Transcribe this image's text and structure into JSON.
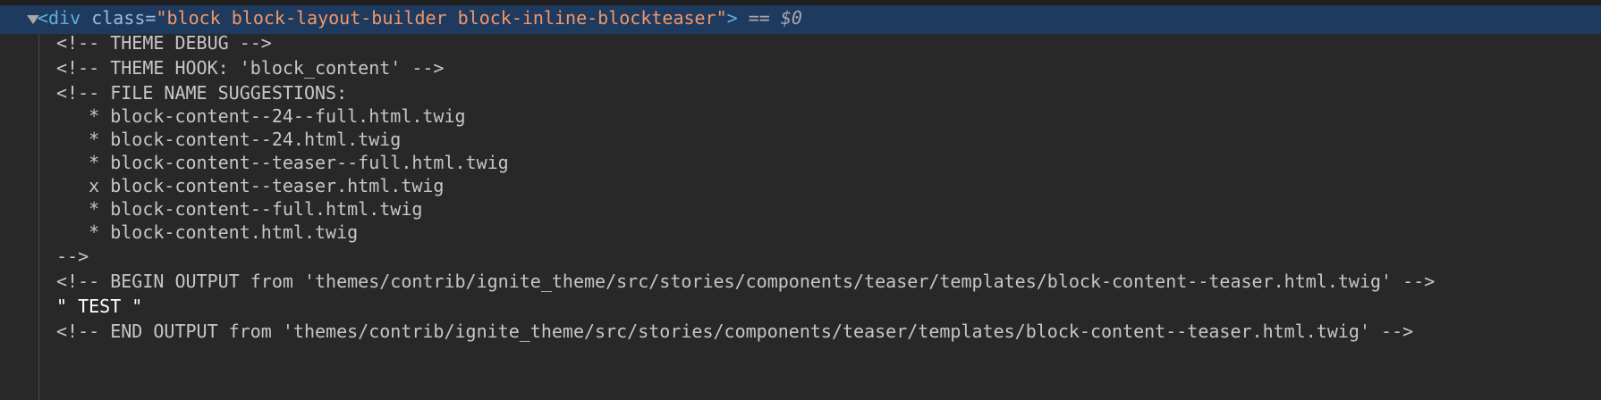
{
  "selected_element": {
    "open_bracket": "<",
    "tag": "div",
    "attr_name": " class",
    "attr_eq": "=",
    "attr_value": "\"block block-layout-builder block-inline-blockteaser\"",
    "close_bracket": ">",
    "eq_marker": " == ",
    "dollar_ref": "$0"
  },
  "comment_lines": [
    "<!-- THEME DEBUG -->",
    "<!-- THEME HOOK: 'block_content' -->",
    "<!-- FILE NAME SUGGESTIONS:",
    "   * block-content--24--full.html.twig",
    "   * block-content--24.html.twig",
    "   * block-content--teaser--full.html.twig",
    "   x block-content--teaser.html.twig",
    "   * block-content--full.html.twig",
    "   * block-content.html.twig",
    "-->",
    "<!-- BEGIN OUTPUT from 'themes/contrib/ignite_theme/src/stories/components/teaser/templates/block-content--teaser.html.twig' -->"
  ],
  "text_node": "\" TEST \"",
  "end_comment": "<!-- END OUTPUT from 'themes/contrib/ignite_theme/src/stories/components/teaser/templates/block-content--teaser.html.twig' -->",
  "colors": {
    "background": "#282828",
    "selection": "#1f3a5f",
    "tag": "#5db0d7",
    "attr_name": "#9bbbdc",
    "attr_value": "#f29766",
    "comment": "#c6c6c6"
  }
}
